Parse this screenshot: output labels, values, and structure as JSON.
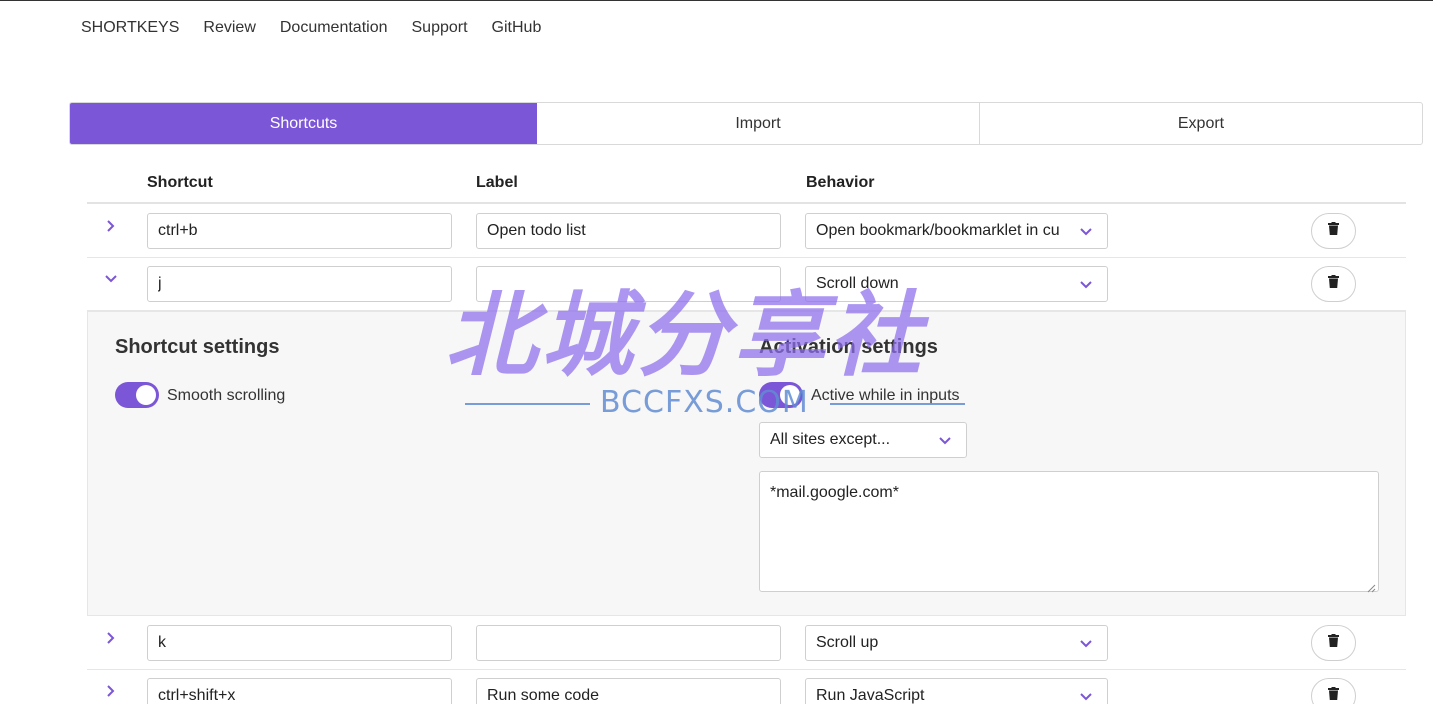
{
  "nav": [
    "SHORTKEYS",
    "Review",
    "Documentation",
    "Support",
    "GitHub"
  ],
  "tabs": [
    "Shortcuts",
    "Import",
    "Export"
  ],
  "columns": {
    "shortcut": "Shortcut",
    "label": "Label",
    "behavior": "Behavior"
  },
  "rows": [
    {
      "shortcut": "ctrl+b",
      "label": "Open todo list",
      "behavior": "Open bookmark/bookmarklet in cu",
      "expanded": false
    },
    {
      "shortcut": "j",
      "label": "",
      "behavior": "Scroll down",
      "expanded": true
    },
    {
      "shortcut": "k",
      "label": "",
      "behavior": "Scroll up",
      "expanded": false
    },
    {
      "shortcut": "ctrl+shift+x",
      "label": "Run some code",
      "behavior": "Run JavaScript",
      "expanded": false
    }
  ],
  "settings": {
    "shortcut_title": "Shortcut settings",
    "smooth_scrolling": "Smooth scrolling",
    "activation_title": "Activation settings",
    "active_inputs": "Active while in inputs",
    "sites_mode": "All sites except...",
    "sites_list": "*mail.google.com*"
  },
  "watermark": {
    "text": "北城分享社",
    "sub": "BCCFXS.COM"
  },
  "colors": {
    "accent": "#7b56d6"
  }
}
